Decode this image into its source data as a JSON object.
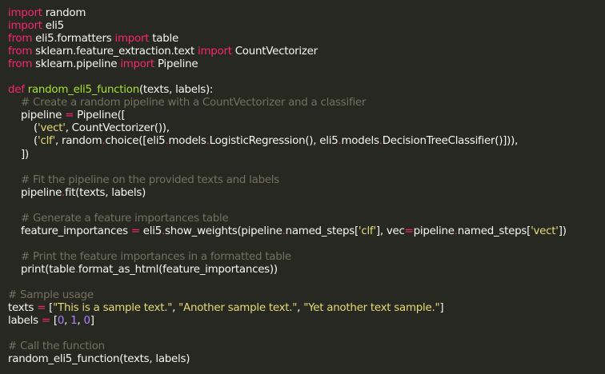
{
  "theme": {
    "background": "#272822",
    "plain": "#f8f8f2",
    "keyword": "#f92672",
    "function_name": "#a6e22e",
    "string": "#e6db74",
    "comment": "#75715e",
    "number": "#ae81ff"
  },
  "code": {
    "lines": [
      [
        {
          "t": "import",
          "k": "kw"
        },
        {
          "t": " random",
          "k": "pl"
        }
      ],
      [
        {
          "t": "import",
          "k": "kw"
        },
        {
          "t": " eli5",
          "k": "pl"
        }
      ],
      [
        {
          "t": "from",
          "k": "kw"
        },
        {
          "t": " eli5.formatters ",
          "k": "pl"
        },
        {
          "t": "import",
          "k": "kw"
        },
        {
          "t": " table",
          "k": "pl"
        }
      ],
      [
        {
          "t": "from",
          "k": "kw"
        },
        {
          "t": " sklearn.feature_extraction.text ",
          "k": "pl"
        },
        {
          "t": "import",
          "k": "kw"
        },
        {
          "t": " CountVectorizer",
          "k": "pl"
        }
      ],
      [
        {
          "t": "from",
          "k": "kw"
        },
        {
          "t": " sklearn.pipeline ",
          "k": "pl"
        },
        {
          "t": "import",
          "k": "kw"
        },
        {
          "t": " Pipeline",
          "k": "pl"
        }
      ],
      [],
      [
        {
          "t": "def",
          "k": "kw"
        },
        {
          "t": " ",
          "k": "pl"
        },
        {
          "t": "random_eli5_function",
          "k": "fn"
        },
        {
          "t": "(texts, labels):",
          "k": "pl"
        }
      ],
      [
        {
          "t": "    ",
          "k": "pl"
        },
        {
          "t": "# Create a random pipeline with a CountVectorizer and a classifier",
          "k": "cm"
        }
      ],
      [
        {
          "t": "    pipeline ",
          "k": "pl"
        },
        {
          "t": "=",
          "k": "kw"
        },
        {
          "t": " Pipeline([",
          "k": "pl"
        }
      ],
      [
        {
          "t": "        (",
          "k": "pl"
        },
        {
          "t": "'vect'",
          "k": "str"
        },
        {
          "t": ", CountVectorizer()),",
          "k": "pl"
        }
      ],
      [
        {
          "t": "        (",
          "k": "pl"
        },
        {
          "t": "'clf'",
          "k": "str"
        },
        {
          "t": ", random",
          "k": "pl"
        },
        {
          "t": ".",
          "k": "kw"
        },
        {
          "t": "choice([eli5",
          "k": "pl"
        },
        {
          "t": ".",
          "k": "kw"
        },
        {
          "t": "models",
          "k": "pl"
        },
        {
          "t": ".",
          "k": "kw"
        },
        {
          "t": "LogisticRegression(), eli5",
          "k": "pl"
        },
        {
          "t": ".",
          "k": "kw"
        },
        {
          "t": "models",
          "k": "pl"
        },
        {
          "t": ".",
          "k": "kw"
        },
        {
          "t": "DecisionTreeClassifier()])),",
          "k": "pl"
        }
      ],
      [
        {
          "t": "    ])",
          "k": "pl"
        }
      ],
      [],
      [
        {
          "t": "    ",
          "k": "pl"
        },
        {
          "t": "# Fit the pipeline on the provided texts and labels",
          "k": "cm"
        }
      ],
      [
        {
          "t": "    pipeline",
          "k": "pl"
        },
        {
          "t": ".",
          "k": "kw"
        },
        {
          "t": "fit(texts, labels)",
          "k": "pl"
        }
      ],
      [],
      [
        {
          "t": "    ",
          "k": "pl"
        },
        {
          "t": "# Generate a feature importances table",
          "k": "cm"
        }
      ],
      [
        {
          "t": "    feature_importances ",
          "k": "pl"
        },
        {
          "t": "=",
          "k": "kw"
        },
        {
          "t": " eli5",
          "k": "pl"
        },
        {
          "t": ".",
          "k": "kw"
        },
        {
          "t": "show_weights(pipeline",
          "k": "pl"
        },
        {
          "t": ".",
          "k": "kw"
        },
        {
          "t": "named_steps[",
          "k": "pl"
        },
        {
          "t": "'clf'",
          "k": "str"
        },
        {
          "t": "], vec",
          "k": "pl"
        },
        {
          "t": "=",
          "k": "kw"
        },
        {
          "t": "pipeline",
          "k": "pl"
        },
        {
          "t": ".",
          "k": "kw"
        },
        {
          "t": "named_steps[",
          "k": "pl"
        },
        {
          "t": "'vect'",
          "k": "str"
        },
        {
          "t": "])",
          "k": "pl"
        }
      ],
      [],
      [
        {
          "t": "    ",
          "k": "pl"
        },
        {
          "t": "# Print the feature importances in a formatted table",
          "k": "cm"
        }
      ],
      [
        {
          "t": "    print(table",
          "k": "pl"
        },
        {
          "t": ".",
          "k": "kw"
        },
        {
          "t": "format_as_html(feature_importances))",
          "k": "pl"
        }
      ],
      [],
      [
        {
          "t": "# Sample usage",
          "k": "cm"
        }
      ],
      [
        {
          "t": "texts ",
          "k": "pl"
        },
        {
          "t": "=",
          "k": "kw"
        },
        {
          "t": " [",
          "k": "pl"
        },
        {
          "t": "\"This is a sample text.\"",
          "k": "str"
        },
        {
          "t": ", ",
          "k": "pl"
        },
        {
          "t": "\"Another sample text.\"",
          "k": "str"
        },
        {
          "t": ", ",
          "k": "pl"
        },
        {
          "t": "\"Yet another text sample.\"",
          "k": "str"
        },
        {
          "t": "]",
          "k": "pl"
        }
      ],
      [
        {
          "t": "labels ",
          "k": "pl"
        },
        {
          "t": "=",
          "k": "kw"
        },
        {
          "t": " [",
          "k": "pl"
        },
        {
          "t": "0",
          "k": "num"
        },
        {
          "t": ", ",
          "k": "pl"
        },
        {
          "t": "1",
          "k": "num"
        },
        {
          "t": ", ",
          "k": "pl"
        },
        {
          "t": "0",
          "k": "num"
        },
        {
          "t": "]",
          "k": "pl"
        }
      ],
      [],
      [
        {
          "t": "# Call the function",
          "k": "cm"
        }
      ],
      [
        {
          "t": "random_eli5_function(texts, labels)",
          "k": "pl"
        }
      ]
    ]
  }
}
